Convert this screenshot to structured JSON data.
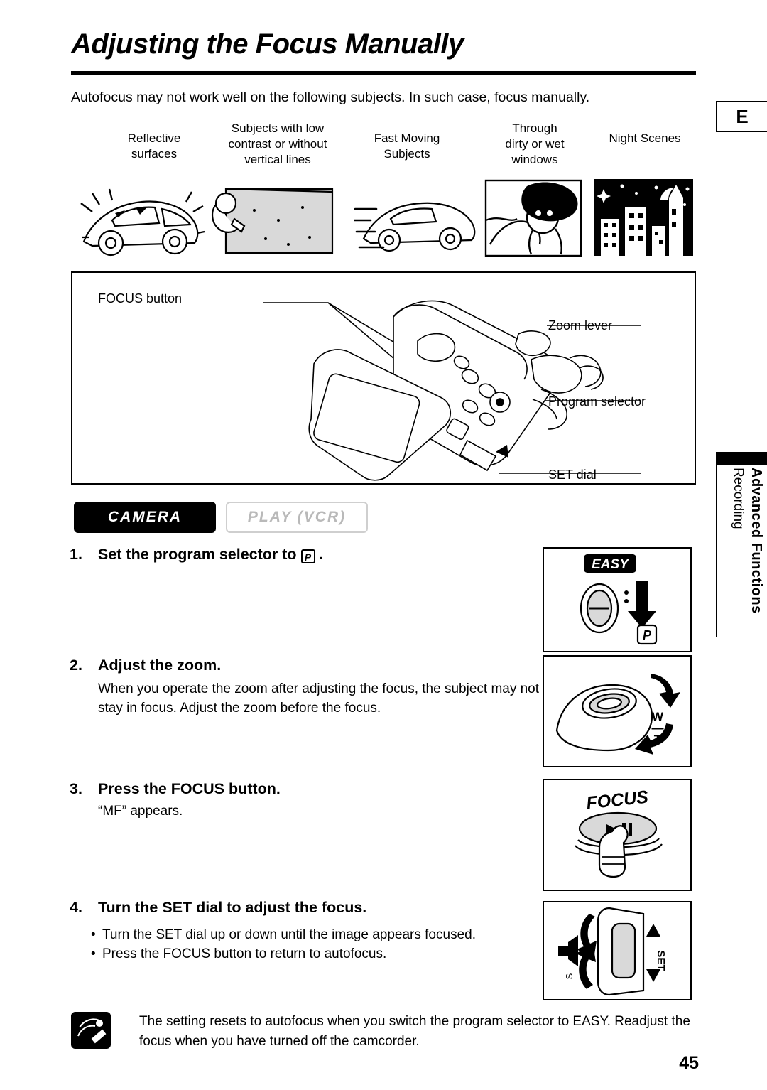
{
  "page": {
    "title": "Adjusting the Focus Manually",
    "edition_tab": "E",
    "page_number": "45",
    "intro": "Autofocus may not work well on the following subjects. In such case, focus manually."
  },
  "subject_captions": [
    "Reflective\nsurfaces",
    "Subjects with low\ncontrast or without\nvertical lines",
    "Fast Moving\nSubjects",
    "Through\ndirty or wet\nwindows",
    "Night Scenes"
  ],
  "camera_diagram": {
    "labels": {
      "focus_button": "FOCUS button",
      "zoom_lever": "Zoom lever",
      "program_selector": "Program selector",
      "set_dial": "SET dial"
    }
  },
  "mode_badges": {
    "camera": "CAMERA",
    "vcr": "PLAY (VCR)"
  },
  "side_tab": {
    "line1": "Advanced Functions",
    "line2": "Recording"
  },
  "steps": [
    {
      "number": "1.",
      "heading_before": "Set the program selector to",
      "heading_after": ".",
      "icon": "program-p-icon",
      "body": ""
    },
    {
      "number": "2.",
      "heading": "Adjust the zoom.",
      "body": "When you operate the zoom after adjusting the focus, the subject may not stay in focus. Adjust the zoom before the focus."
    },
    {
      "number": "3.",
      "heading": "Press the FOCUS button.",
      "body": "“MF” appears."
    },
    {
      "number": "4.",
      "heading": "Turn the SET dial to adjust the focus.",
      "bullets": [
        "Turn the SET dial up or down until the image appears focused.",
        "Press the FOCUS button to return to autofocus."
      ]
    }
  ],
  "illustration_labels": {
    "easy_badge": "EASY",
    "p_badge": "P",
    "zoom_w": "W",
    "zoom_t": "T",
    "focus_label": "FOCUS",
    "set_label": "SET"
  },
  "note": "The setting resets to autofocus when you switch the program selector to EASY. Readjust the focus when you have turned off the camcorder.",
  "colors": {
    "ink": "#000000",
    "paper": "#ffffff",
    "disabled": "#b9b9b9",
    "shade": "#d9d9d9"
  }
}
